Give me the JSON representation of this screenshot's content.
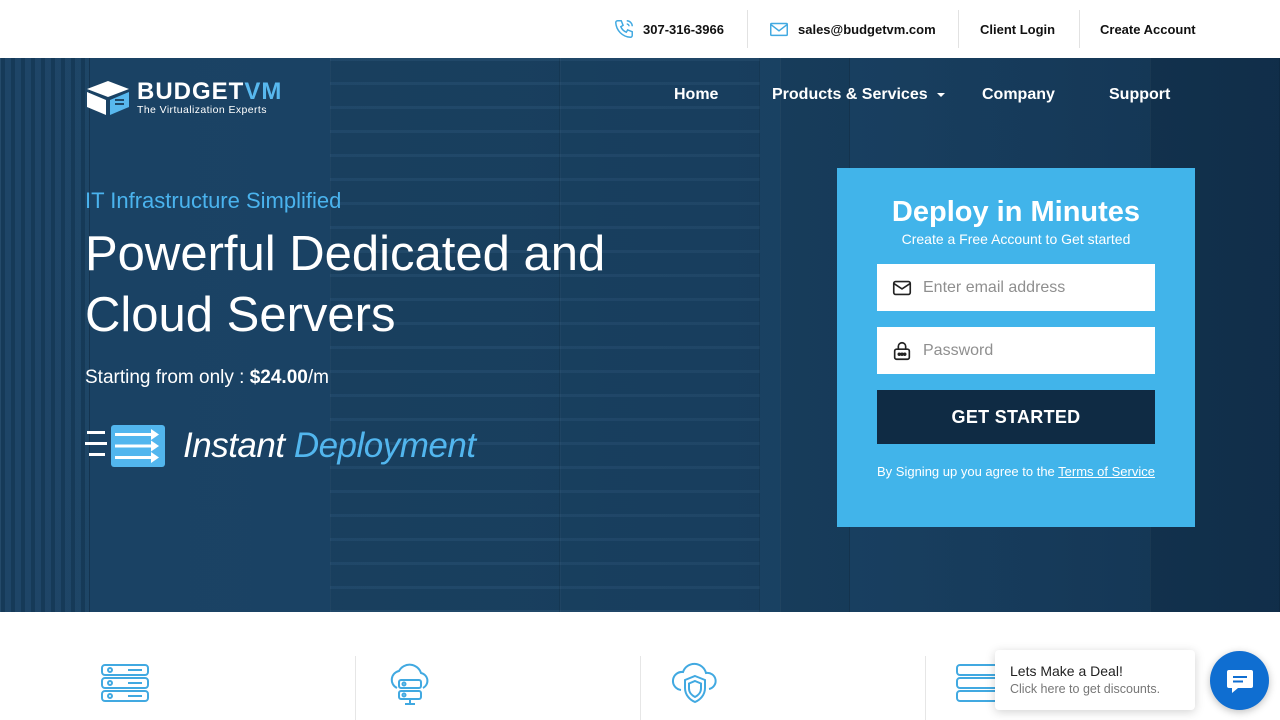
{
  "topbar": {
    "phone": "307-316-3966",
    "email": "sales@budgetvm.com",
    "client_login": "Client Login",
    "create_account": "Create Account"
  },
  "brand": {
    "name_part1": "BUDGET",
    "name_part2": "VM",
    "tagline": "The Virtualization Experts"
  },
  "nav": {
    "home": "Home",
    "products": "Products & Services",
    "company": "Company",
    "support": "Support"
  },
  "hero": {
    "eyebrow": "IT Infrastructure Simplified",
    "headline_line1": "Powerful Dedicated and",
    "headline_line2": "Cloud Servers",
    "price_prefix": "Starting from only : ",
    "price_value": "$24.00",
    "price_suffix": "/m",
    "instant_word1": "Instant",
    "instant_word2": "Deployment"
  },
  "signup": {
    "title": "Deploy in Minutes",
    "subtitle": "Create a Free Account to Get started",
    "email_placeholder": "Enter email address",
    "password_placeholder": "Password",
    "button_label": "GET STARTED",
    "terms_prefix": "By Signing up you agree to the ",
    "terms_link": "Terms of Service"
  },
  "features": {
    "icons": [
      "server-stack-icon",
      "cloud-server-icon",
      "cloud-shield-icon",
      "server-stack-icon"
    ]
  },
  "chat": {
    "title": "Lets Make a Deal!",
    "subtitle": "Click here to get discounts."
  },
  "colors": {
    "accent": "#41b4ea",
    "button_dark": "#0f2b44",
    "hero_bg": "#1f4868",
    "chat_blue": "#0f6ed1"
  }
}
